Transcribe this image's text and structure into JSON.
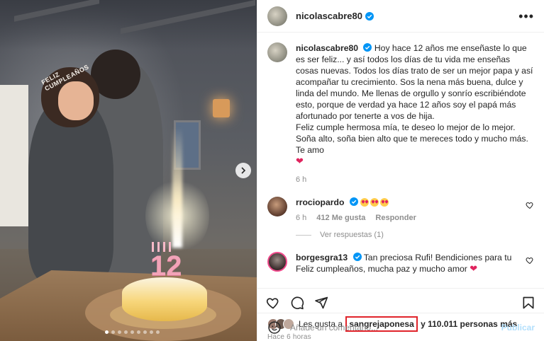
{
  "post": {
    "username": "nicolascabre80",
    "caption_user": "nicolascabre80",
    "caption_text": "Hoy hace 12 años me enseñaste lo que es ser feliz... y así todos los días de tu vida me enseñas cosas nuevas. Todos los días trato de ser un mejor papa y así acompañar tu crecimiento. Sos la nena más buena, dulce y linda del mundo. Me llenas de orgullo y sonrío escribiéndote esto, porque de verdad ya hace 12 años soy el papá más afortunado por tenerte a vos de hija.",
    "caption_text2": "Feliz cumple hermosa mía, te deseo lo mejor de lo mejor. Soña alto, soña bien alto que te mereces todo y mucho más. Te amo",
    "caption_time": "6 h",
    "photo_tiara_text": "FELIZ CUMPLEAÑOS",
    "photo_cake_number": "12"
  },
  "comments": [
    {
      "username": "rrociopardo",
      "time": "6 h",
      "likes": "412 Me gusta",
      "reply": "Responder",
      "view_replies": "Ver respuestas (1)"
    },
    {
      "username": "borgesgra13",
      "text": "Tan preciosa Rufi! Bendiciones para tu Feliz cumpleaños, mucha paz y mucho amor"
    }
  ],
  "likes": {
    "prefix": "Les gusta a",
    "highlight_user": "sangrejaponesa",
    "suffix": "y 110.011 personas más",
    "ago": "Hace 6 horas"
  },
  "composer": {
    "placeholder": "Añade un comentario...",
    "publish": "Publicar"
  },
  "colors": {
    "highlight_border": "#e0242b",
    "verified": "#0095f6",
    "publish_disabled": "#b2dffc"
  },
  "icons": [
    "verified-icon",
    "more-icon",
    "heart-icon",
    "comment-icon",
    "share-icon",
    "save-icon",
    "emoji-icon",
    "next-arrow-icon"
  ]
}
